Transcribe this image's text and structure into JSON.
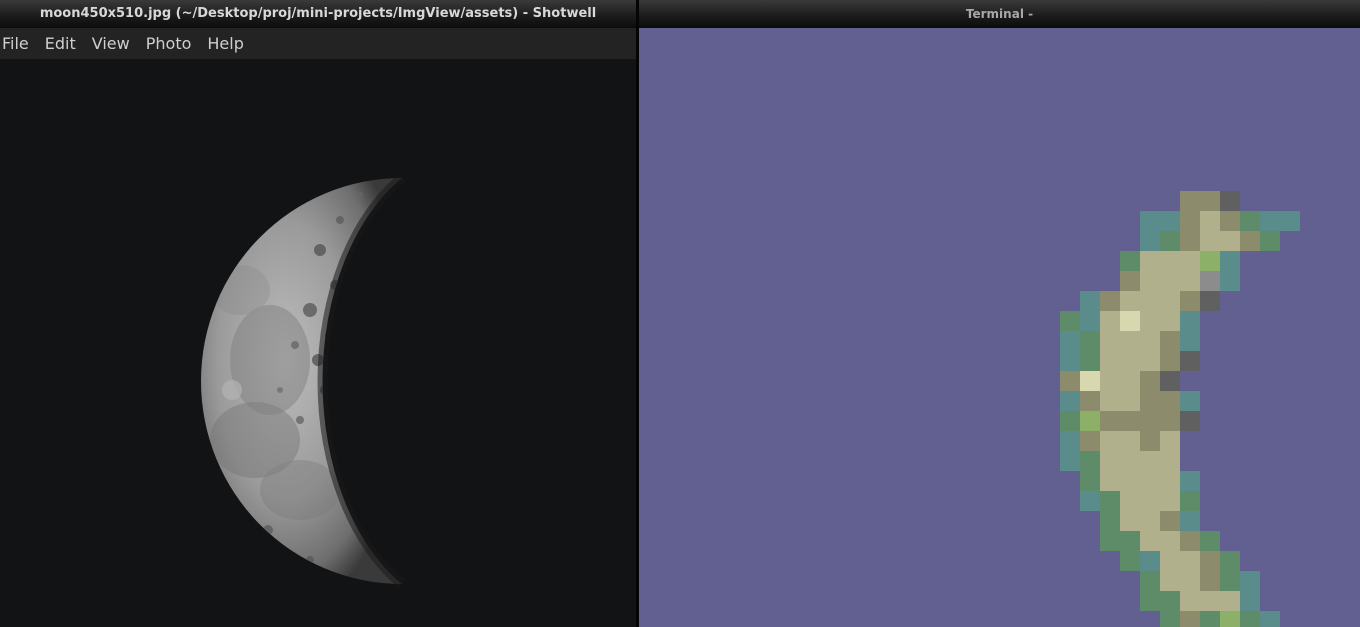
{
  "shotwell": {
    "title": "moon450x510.jpg (~/Desktop/proj/mini-projects/ImgView/assets) - Shotwell",
    "menu": [
      "File",
      "Edit",
      "View",
      "Photo",
      "Help"
    ],
    "photo_icon": "moon-photo"
  },
  "terminal": {
    "title": "Terminal -",
    "pixel_art_icon": "pixelated-moon",
    "colors": {
      "background": "#616090",
      "pale": "#b0b08c",
      "olive": "#8c8c6c",
      "green": "#5e8c68",
      "teal": "#5a8c8c",
      "bright": "#8cb068",
      "highlight": "#d8d8b0",
      "gray": "#606060",
      "lightgray": "#8c8c8c"
    }
  }
}
